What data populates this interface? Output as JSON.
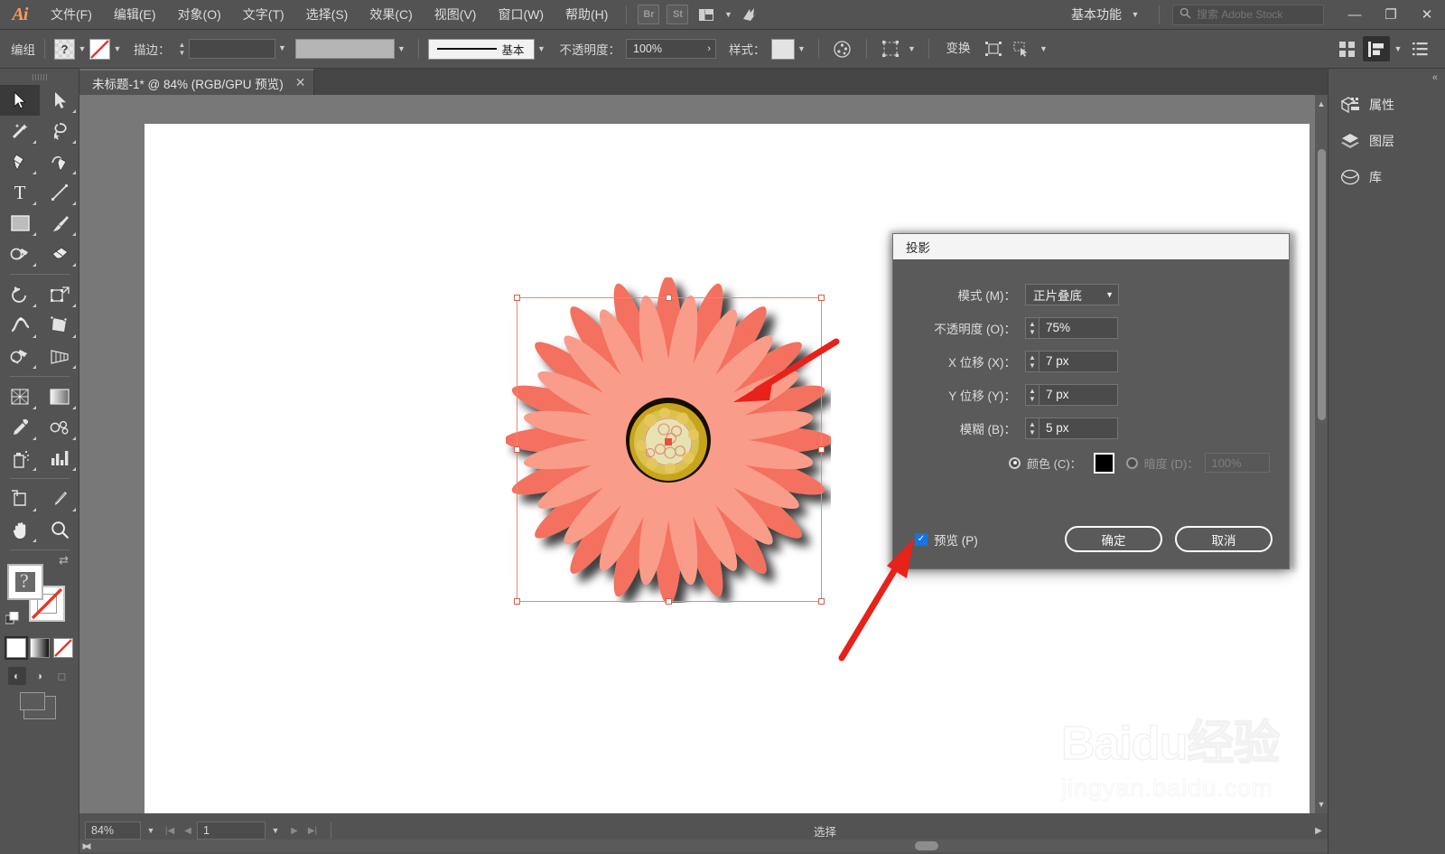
{
  "app": {
    "logo": "Ai",
    "name": "Adobe Illustrator"
  },
  "menubar": {
    "items": [
      {
        "label": "文件(F)"
      },
      {
        "label": "编辑(E)"
      },
      {
        "label": "对象(O)"
      },
      {
        "label": "文字(T)"
      },
      {
        "label": "选择(S)"
      },
      {
        "label": "效果(C)"
      },
      {
        "label": "视图(V)"
      },
      {
        "label": "窗口(W)"
      },
      {
        "label": "帮助(H)"
      }
    ],
    "bridge_label": "Br",
    "stock_label": "St",
    "arrange_icon": "arrange-documents-icon",
    "sync_icon": "sync-settings-icon",
    "workspace": "基本功能",
    "search_placeholder": "搜索 Adobe Stock",
    "window_buttons": {
      "minimize": "—",
      "maximize": "❐",
      "close": "✕"
    }
  },
  "controlbar": {
    "selection_label": "编组",
    "fill_label": "fill-swatch",
    "stroke_label": "描边：",
    "stroke_weight": "",
    "stroke_profile": "",
    "brush_label": "基本",
    "opacity_label": "不透明度：",
    "opacity_value": "100%",
    "style_label": "样式：",
    "recolor_icon": "recolor-artwork-icon",
    "select_similar_icon": "select-similar-icon",
    "transform_label": "变换",
    "isolate_icon": "isolate-group-icon",
    "anchor_icon": "anchor-point-icon",
    "align_icon": "align-panel-icon",
    "arrange_icon": "arrange-objects-icon",
    "options_icon": "panel-options-icon"
  },
  "document": {
    "tab_title": "未标题-1* @ 84% (RGB/GPU 预览)",
    "close_label": "✕"
  },
  "toolbar": {
    "tools": [
      {
        "name": "selection-tool",
        "glyph": "selection",
        "active": true
      },
      {
        "name": "direct-selection-tool",
        "glyph": "direct-selection",
        "active": false
      },
      {
        "name": "magic-wand-tool",
        "glyph": "magic-wand",
        "active": false
      },
      {
        "name": "lasso-tool",
        "glyph": "lasso",
        "active": false
      },
      {
        "name": "pen-tool",
        "glyph": "pen",
        "active": false
      },
      {
        "name": "curvature-tool",
        "glyph": "curvature",
        "active": false
      },
      {
        "name": "type-tool",
        "glyph": "type",
        "active": false
      },
      {
        "name": "line-segment-tool",
        "glyph": "line",
        "active": false
      },
      {
        "name": "rectangle-tool",
        "glyph": "rectangle",
        "active": false
      },
      {
        "name": "paintbrush-tool",
        "glyph": "paintbrush",
        "active": false
      },
      {
        "name": "shaper-tool",
        "glyph": "shaper",
        "active": false
      },
      {
        "name": "eraser-tool",
        "glyph": "eraser",
        "active": false
      },
      {
        "name": "rotate-tool",
        "glyph": "rotate",
        "active": false
      },
      {
        "name": "scale-tool",
        "glyph": "scale",
        "active": false
      },
      {
        "name": "width-tool",
        "glyph": "width",
        "active": false
      },
      {
        "name": "free-transform-tool",
        "glyph": "free-transform",
        "active": false
      },
      {
        "name": "shape-builder-tool",
        "glyph": "shape-builder",
        "active": false
      },
      {
        "name": "perspective-grid-tool",
        "glyph": "perspective",
        "active": false
      },
      {
        "name": "mesh-tool",
        "glyph": "mesh",
        "active": false
      },
      {
        "name": "gradient-tool",
        "glyph": "gradient",
        "active": false
      },
      {
        "name": "eyedropper-tool",
        "glyph": "eyedropper",
        "active": false
      },
      {
        "name": "blend-tool",
        "glyph": "blend",
        "active": false
      },
      {
        "name": "symbol-sprayer-tool",
        "glyph": "symbol-sprayer",
        "active": false
      },
      {
        "name": "column-graph-tool",
        "glyph": "column-graph",
        "active": false
      },
      {
        "name": "artboard-tool",
        "glyph": "artboard",
        "active": false
      },
      {
        "name": "slice-tool",
        "glyph": "slice",
        "active": false
      },
      {
        "name": "hand-tool",
        "glyph": "hand",
        "active": false
      },
      {
        "name": "zoom-tool",
        "glyph": "zoom",
        "active": false
      }
    ],
    "fill_stroke": {
      "fill_state": "unknown",
      "stroke_state": "none",
      "swap_icon": "swap-fill-stroke-icon",
      "default_icon": "default-fill-stroke-icon"
    },
    "color_modes": [
      {
        "name": "color-mode-button",
        "selected": true
      },
      {
        "name": "gradient-mode-button",
        "selected": false
      },
      {
        "name": "none-mode-button",
        "selected": false
      }
    ],
    "screen_modes": [
      {
        "name": "normal-screen-mode",
        "selected": true
      },
      {
        "name": "full-screen-menubar-mode",
        "selected": false
      },
      {
        "name": "full-screen-mode",
        "selected": false
      }
    ]
  },
  "rightpanel": {
    "items": [
      {
        "label": "属性",
        "icon": "properties-icon"
      },
      {
        "label": "图层",
        "icon": "layers-icon"
      },
      {
        "label": "库",
        "icon": "libraries-icon"
      }
    ],
    "collapse_icon": "expand-panels-icon"
  },
  "dialog": {
    "title": "投影",
    "fields": [
      {
        "label": "模式 (M)：",
        "type": "select",
        "value": "正片叠底"
      },
      {
        "label": "不透明度 (O)：",
        "type": "stepper",
        "value": "75%"
      },
      {
        "label": "X 位移 (X)：",
        "type": "stepper",
        "value": "7 px"
      },
      {
        "label": "Y 位移 (Y)：",
        "type": "stepper",
        "value": "7 px"
      },
      {
        "label": "模糊 (B)：",
        "type": "stepper",
        "value": "5 px"
      }
    ],
    "color_radio_label": "颜色 (C)：",
    "color_value": "#000000",
    "darkness_radio_label": "暗度 (D)：",
    "darkness_value": "100%",
    "preview_label": "预览 (P)",
    "preview_checked": true,
    "ok_label": "确定",
    "cancel_label": "取消"
  },
  "statusbar": {
    "zoom": "84%",
    "page": "1",
    "status_text": "选择"
  },
  "artwork": {
    "name": "gerbera-daisy-flower",
    "petal_outer_color": "#f4705e",
    "petal_inner_color": "#f99684",
    "center_ring_color": "#c8a41e",
    "center_core_color": "#e0dca0",
    "center_outline_color": "#1a0d05"
  },
  "watermark": {
    "main": "Baidu经验",
    "sub": "jingyan.baidu.com"
  },
  "annotations": [
    {
      "name": "arrow-pointing-to-shadow"
    },
    {
      "name": "arrow-pointing-to-preview-checkbox"
    }
  ]
}
